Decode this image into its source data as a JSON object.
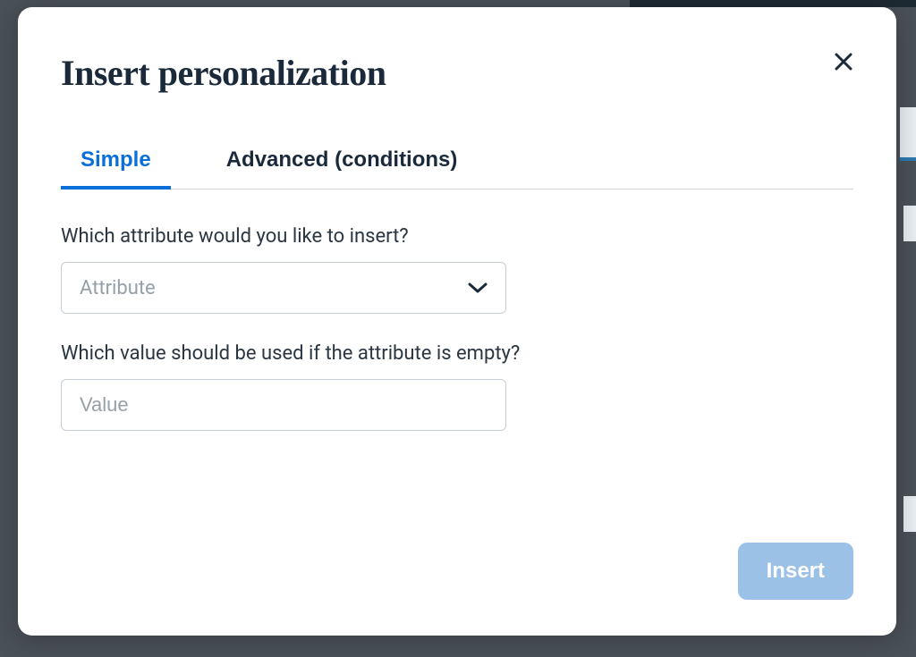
{
  "modal": {
    "title": "Insert personalization",
    "close_icon": "close-icon"
  },
  "tabs": {
    "simple": "Simple",
    "advanced": "Advanced (conditions)"
  },
  "fields": {
    "attribute": {
      "label": "Which attribute would you like to insert?",
      "placeholder": "Attribute"
    },
    "fallback": {
      "label": "Which value should be used if the attribute is empty?",
      "placeholder": "Value"
    }
  },
  "actions": {
    "insert": "Insert"
  },
  "colors": {
    "accent": "#0a6fd8",
    "button_bg": "#9cc1e6",
    "title": "#1b2a3a"
  }
}
